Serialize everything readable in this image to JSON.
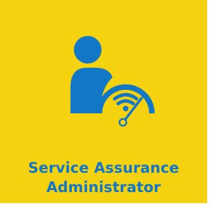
{
  "tile": {
    "title_line1": "Service Assurance",
    "title_line2": "Administrator",
    "icon": "user-with-wifi-gauge-icon",
    "colors": {
      "background": "#f5d20f",
      "accent": "#1277c6"
    }
  }
}
